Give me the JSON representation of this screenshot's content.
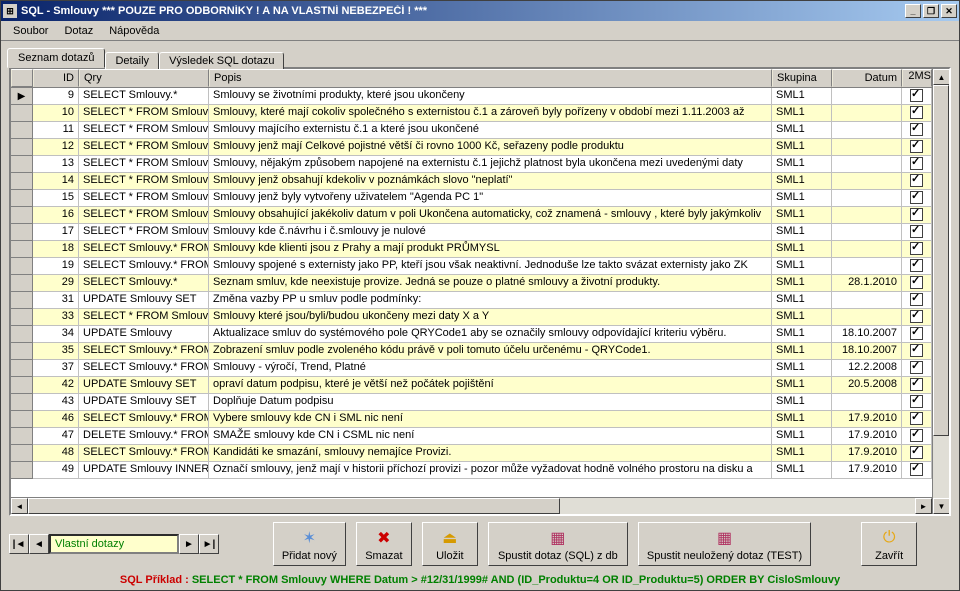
{
  "window": {
    "title": "SQL - Smlouvy   ***  POUZE PRO ODBORNÍKY !  A NA VLASTNÍ NEBEZPEČÍ !   ***"
  },
  "menu": {
    "items": [
      "Soubor",
      "Dotaz",
      "Nápověda"
    ]
  },
  "tabs": [
    {
      "label": "Seznam dotazů",
      "active": true
    },
    {
      "label": "Detaily",
      "active": false
    },
    {
      "label": "Výsledek SQL dotazu",
      "active": false
    }
  ],
  "columns": {
    "id": "ID",
    "qry": "Qry",
    "popis": "Popis",
    "skupina": "Skupina",
    "datum": "Datum",
    "ms": "2MS"
  },
  "rows": [
    {
      "sel": true,
      "id": 9,
      "qry": "SELECT Smlouvy.*",
      "popis": "Smlouvy se životními produkty, které jsou ukončeny",
      "sk": "SML1",
      "datum": "",
      "ms": true,
      "alt": false
    },
    {
      "id": 10,
      "qry": "SELECT * FROM Smlouvy",
      "popis": "Smlouvy, které mají cokoliv společného s externistou č.1 a zároveň byly pořízeny v období mezi 1.11.2003 až",
      "sk": "SML1",
      "datum": "",
      "ms": true,
      "alt": true
    },
    {
      "id": 11,
      "qry": "SELECT * FROM Smlouvy",
      "popis": "Smlouvy majícího externistu č.1 a které jsou ukončené",
      "sk": "SML1",
      "datum": "",
      "ms": true,
      "alt": false
    },
    {
      "id": 12,
      "qry": "SELECT * FROM Smlouvy",
      "popis": "Smlouvy jenž mají Celkové pojistné větší či rovno 1000 Kč, seřazeny podle produktu",
      "sk": "SML1",
      "datum": "",
      "ms": true,
      "alt": true
    },
    {
      "id": 13,
      "qry": "SELECT * FROM Smlouvy",
      "popis": "Smlouvy, nějakým způsobem napojené na externistu č.1 jejichž platnost byla ukončena mezi uvedenými daty",
      "sk": "SML1",
      "datum": "",
      "ms": true,
      "alt": false
    },
    {
      "id": 14,
      "qry": "SELECT * FROM Smlouvy",
      "popis": "Smlouvy jenž obsahují kdekoliv v poznámkách slovo \"neplatí\"",
      "sk": "SML1",
      "datum": "",
      "ms": true,
      "alt": true
    },
    {
      "id": 15,
      "qry": "SELECT * FROM Smlouvy",
      "popis": "Smlouvy jenž byly vytvořeny uživatelem \"Agenda PC 1\"",
      "sk": "SML1",
      "datum": "",
      "ms": true,
      "alt": false
    },
    {
      "id": 16,
      "qry": "SELECT * FROM Smlouvy",
      "popis": "Smlouvy obsahující jakékoliv datum v poli Ukončena automaticky, což znamená - smlouvy , které byly jakýmkoliv",
      "sk": "SML1",
      "datum": "",
      "ms": true,
      "alt": true
    },
    {
      "id": 17,
      "qry": "SELECT * FROM Smlouvy",
      "popis": "Smlouvy kde č.návrhu i č.smlouvy je nulové",
      "sk": "SML1",
      "datum": "",
      "ms": true,
      "alt": false
    },
    {
      "id": 18,
      "qry": "SELECT Smlouvy.* FROM",
      "popis": "Smlouvy kde klienti jsou z Prahy a mají produkt PRŮMYSL",
      "sk": "SML1",
      "datum": "",
      "ms": true,
      "alt": true
    },
    {
      "id": 19,
      "qry": "SELECT Smlouvy.* FROM",
      "popis": "Smlouvy spojené s externisty jako PP, kteří jsou však neaktivní. Jednoduše lze takto svázat externisty jako ZK",
      "sk": "SML1",
      "datum": "",
      "ms": true,
      "alt": false
    },
    {
      "id": 29,
      "qry": "SELECT Smlouvy.*",
      "popis": "Seznam smluv, kde neexistuje provize. Jedná se pouze o platné smlouvy a životní produkty.",
      "sk": "SML1",
      "datum": "28.1.2010",
      "ms": true,
      "alt": true
    },
    {
      "id": 31,
      "qry": "UPDATE Smlouvy SET",
      "popis": "Změna vazby PP u smluv podle podmínky:",
      "sk": "SML1",
      "datum": "",
      "ms": true,
      "alt": false
    },
    {
      "id": 33,
      "qry": "SELECT * FROM Smlouvy",
      "popis": "Smlouvy které jsou/byli/budou ukončeny mezi daty X a Y",
      "sk": "SML1",
      "datum": "",
      "ms": true,
      "alt": true
    },
    {
      "id": 34,
      "qry": "UPDATE Smlouvy",
      "popis": "Aktualizace smluv do systémového pole QRYCode1 aby se označily smlouvy odpovídající kriteriu výběru.",
      "sk": "SML1",
      "datum": "18.10.2007",
      "ms": true,
      "alt": false
    },
    {
      "id": 35,
      "qry": "SELECT Smlouvy.* FROM",
      "popis": "Zobrazení smluv podle zvoleného kódu právě v poli tomuto účelu určenému - QRYCode1.",
      "sk": "SML1",
      "datum": "18.10.2007",
      "ms": true,
      "alt": true
    },
    {
      "id": 37,
      "qry": "SELECT Smlouvy.* FROM",
      "popis": "Smlouvy - výročí, Trend, Platné",
      "sk": "SML1",
      "datum": "12.2.2008",
      "ms": true,
      "alt": false
    },
    {
      "id": 42,
      "qry": "UPDATE Smlouvy SET",
      "popis": "opraví datum podpisu, které je větší než počátek pojištění",
      "sk": "SML1",
      "datum": "20.5.2008",
      "ms": true,
      "alt": true
    },
    {
      "id": 43,
      "qry": "UPDATE Smlouvy SET",
      "popis": "Doplňuje Datum podpisu",
      "sk": "SML1",
      "datum": "",
      "ms": true,
      "alt": false
    },
    {
      "id": 46,
      "qry": "SELECT Smlouvy.* FROM",
      "popis": "Vybere smlouvy kde CN i SML nic není",
      "sk": "SML1",
      "datum": "17.9.2010",
      "ms": true,
      "alt": true
    },
    {
      "id": 47,
      "qry": "DELETE Smlouvy.* FROM",
      "popis": "SMAŽE smlouvy kde CN i CSML nic není",
      "sk": "SML1",
      "datum": "17.9.2010",
      "ms": true,
      "alt": false
    },
    {
      "id": 48,
      "qry": "SELECT Smlouvy.* FROM",
      "popis": "Kandidáti ke smazání, smlouvy nemajíce Provizi.",
      "sk": "SML1",
      "datum": "17.9.2010",
      "ms": true,
      "alt": true
    },
    {
      "id": 49,
      "qry": "UPDATE Smlouvy INNER",
      "popis": "Označí smlouvy, jenž mají v historii příchozí provizi - pozor může vyžadovat hodně volného prostoru na disku a",
      "sk": "SML1",
      "datum": "17.9.2010",
      "ms": true,
      "alt": false
    }
  ],
  "nav": {
    "label": "Vlastní dotazy"
  },
  "buttons": {
    "add": {
      "label": "Přidat nový",
      "icon": "✶"
    },
    "del": {
      "label": "Smazat",
      "icon": "✖"
    },
    "save": {
      "label": "Uložit",
      "icon": "⏏"
    },
    "run": {
      "label": "Spustit dotaz (SQL) z db",
      "icon": "▦"
    },
    "test": {
      "label": "Spustit neuložený dotaz (TEST)",
      "icon": "▦"
    },
    "close": {
      "label": "Zavřít",
      "icon": "⏻"
    }
  },
  "footer": {
    "label": "SQL Příklad :  ",
    "sql": "SELECT * FROM Smlouvy WHERE Datum > #12/31/1999# AND (ID_Produktu=4 OR ID_Produktu=5) ORDER BY CisloSmlouvy"
  }
}
